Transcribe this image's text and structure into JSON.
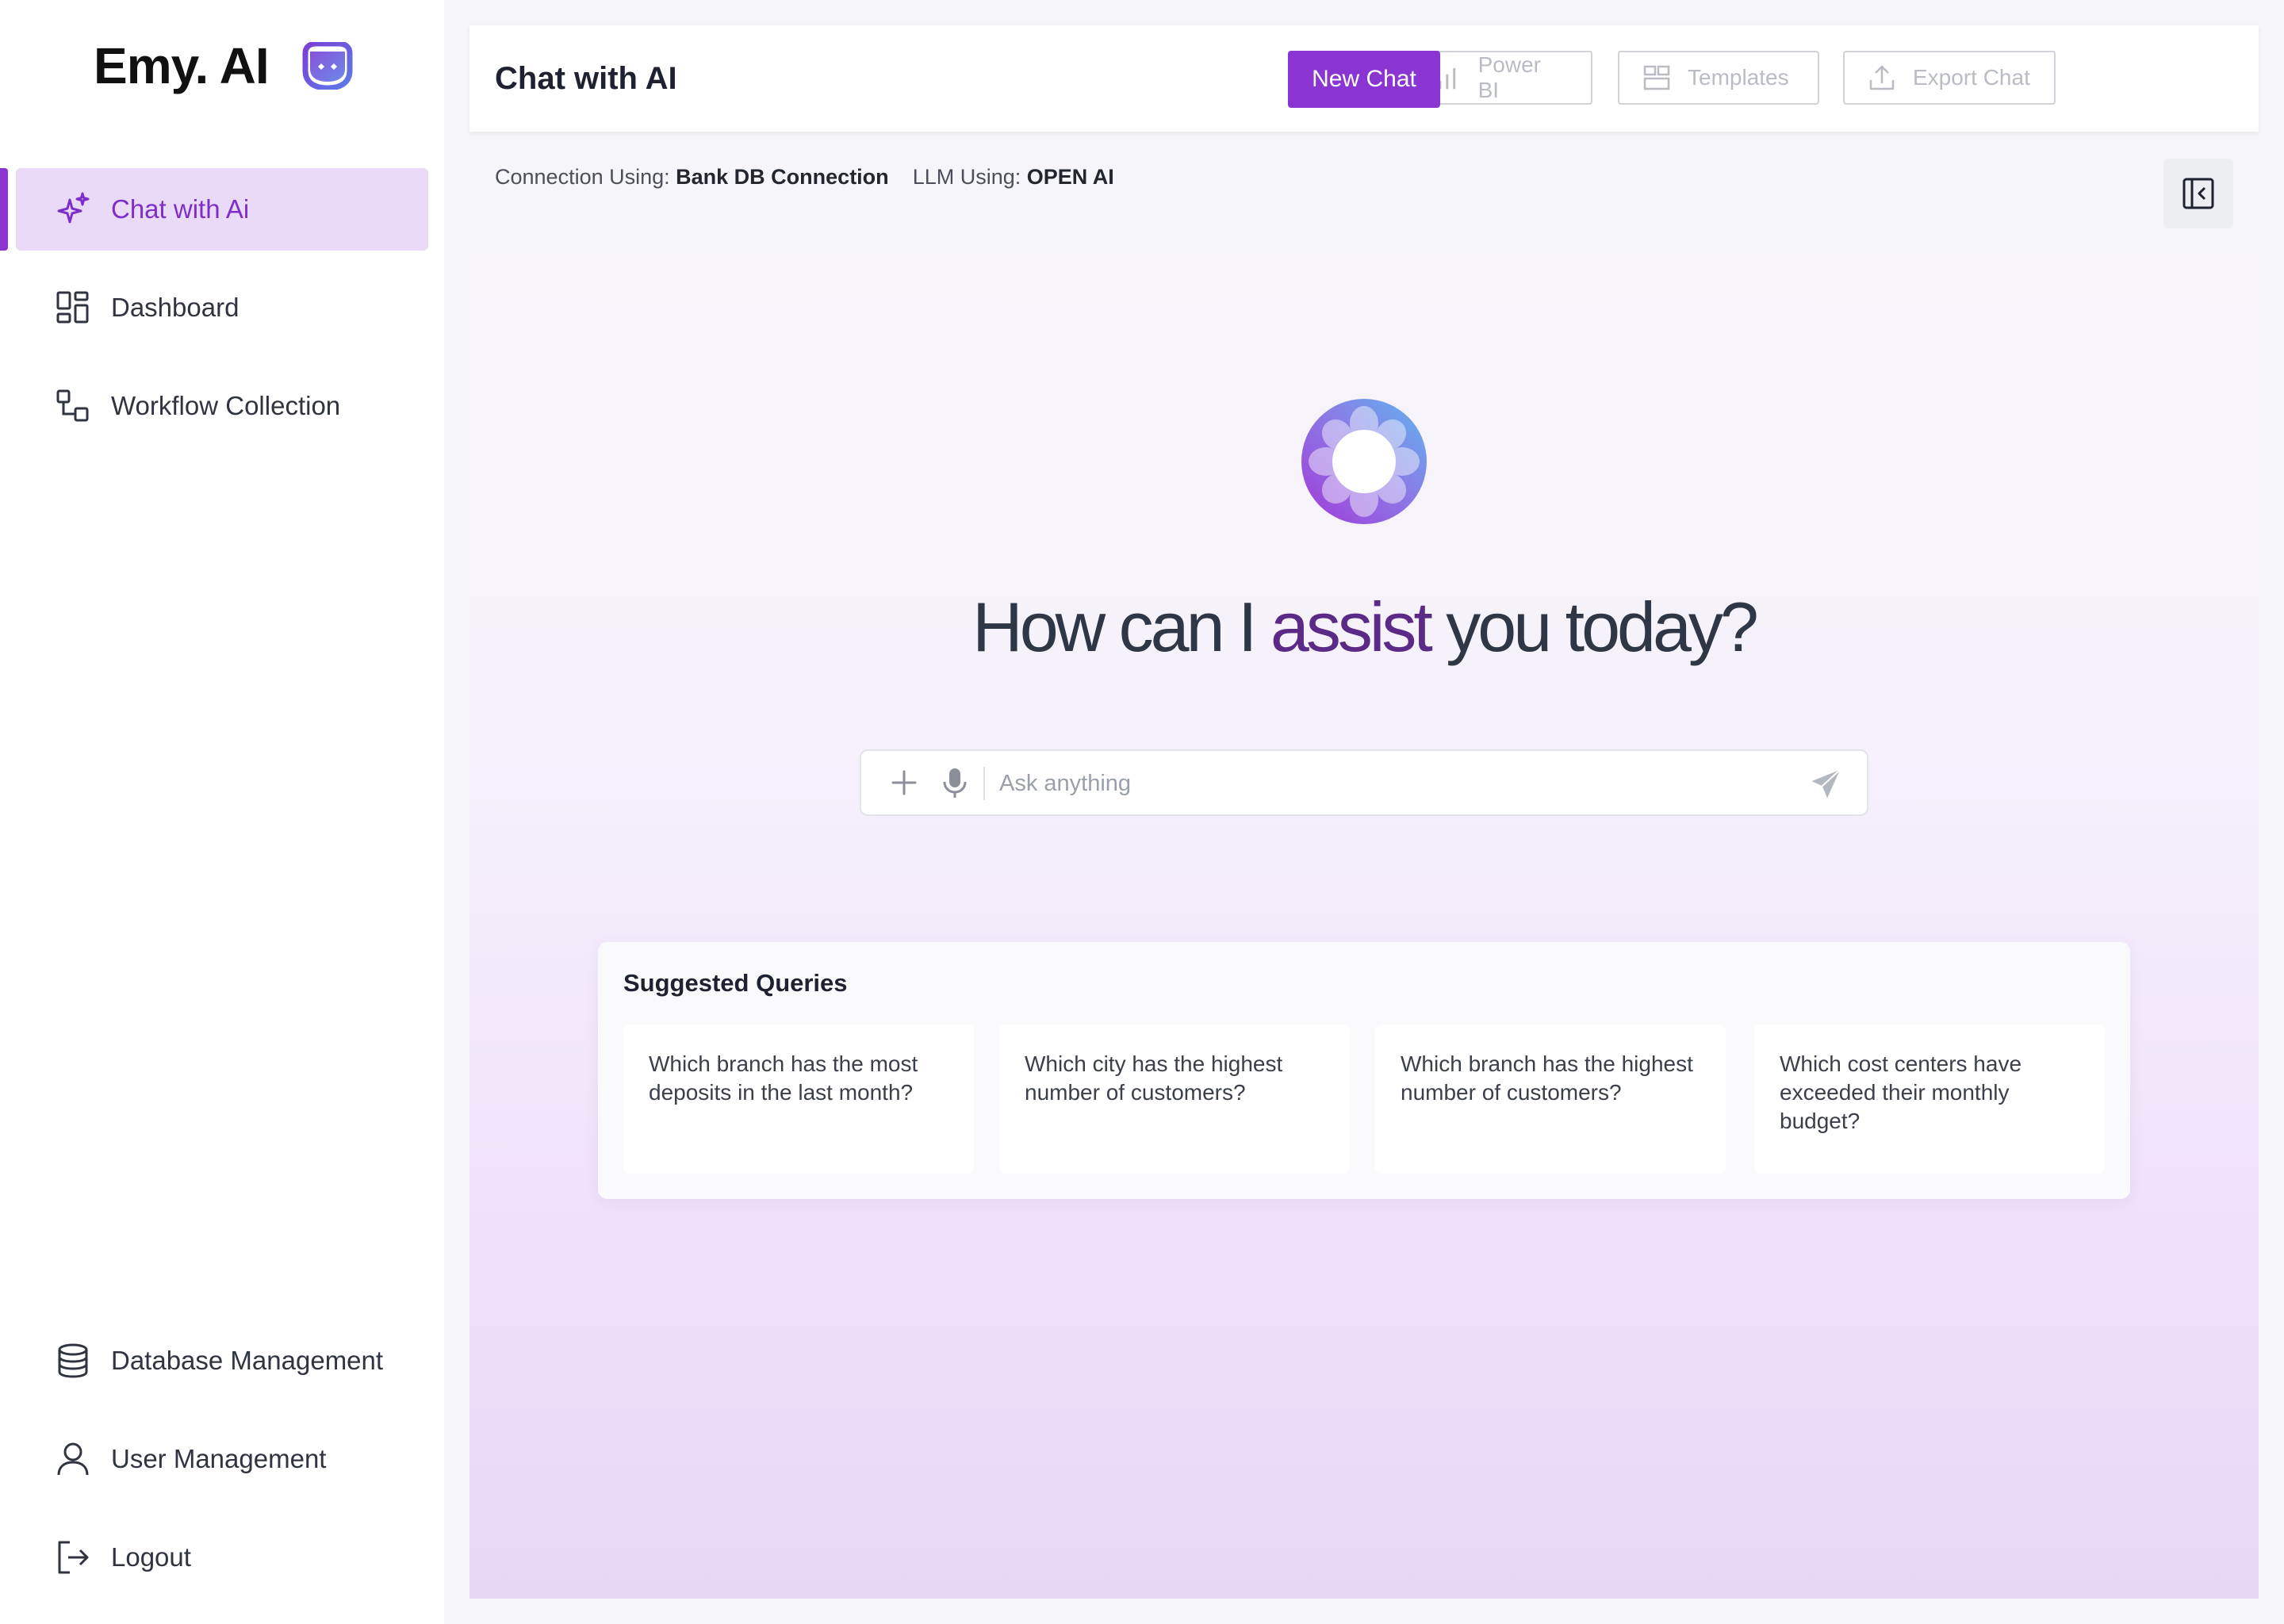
{
  "app": {
    "logo_text": "Emy. AI"
  },
  "sidebar": {
    "top_items": [
      {
        "label": "Chat with Ai",
        "icon": "sparkle-icon",
        "active": true
      },
      {
        "label": "Dashboard",
        "icon": "dashboard-icon"
      },
      {
        "label": "Workflow Collection",
        "icon": "workflow-icon"
      }
    ],
    "bottom_items": [
      {
        "label": "Database Management",
        "icon": "database-icon"
      },
      {
        "label": "User Management",
        "icon": "user-icon"
      },
      {
        "label": "Logout",
        "icon": "logout-icon"
      }
    ]
  },
  "header": {
    "title": "Chat with AI",
    "buttons": {
      "power_bi": "Power BI",
      "templates": "Templates",
      "export_chat": "Export Chat",
      "new_chat": "New Chat"
    }
  },
  "connection": {
    "label": "Connection Using:",
    "value": "Bank DB Connection",
    "llm_label": "LLM Using:",
    "llm_value": "OPEN AI"
  },
  "hero": {
    "before": "How can I ",
    "accent": "assist",
    "after": " you today?"
  },
  "input": {
    "placeholder": "Ask anything"
  },
  "suggestions": {
    "title": "Suggested Queries",
    "items": [
      "Which branch has the most deposits in the last month?",
      "Which city has the highest number of customers?",
      "Which branch has the highest number of customers?",
      "Which cost centers have exceeded their monthly budget?"
    ]
  },
  "colors": {
    "accent": "#8a34d1",
    "active_bg": "#e9dbf7",
    "hero_accent": "#5b2a86"
  }
}
